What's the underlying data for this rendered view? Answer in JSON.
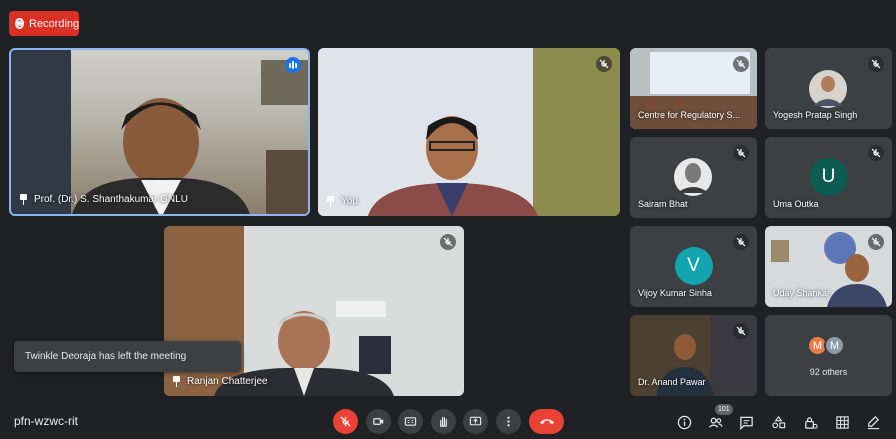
{
  "recording": {
    "label": "Recording"
  },
  "colors": {
    "recording": "#d93025",
    "active_speaker_border": "#8ab4f8",
    "end_call": "#ea4335",
    "avatar_uma": "#0b5c52",
    "avatar_vijoy": "#12a4af",
    "avatar_m1": "#ee7a45",
    "avatar_m2": "#8c9ba7"
  },
  "main_tiles": [
    {
      "name": "Prof. (Dr.) S. Shanthakumar GNLU",
      "speaking": true
    },
    {
      "name": "You",
      "muted": true
    },
    {
      "name": "Ranjan Chatterjee",
      "muted": true
    }
  ],
  "side_tiles": [
    {
      "name": "Centre for Regulatory S...",
      "muted": true
    },
    {
      "name": "Yogesh Pratap Singh",
      "muted": true
    },
    {
      "name": "Sairam Bhat",
      "muted": true
    },
    {
      "name": "Uma Outka",
      "muted": true,
      "initial": "U"
    },
    {
      "name": "Vijoy Kumar Sinha",
      "muted": true,
      "initial": "V"
    },
    {
      "name": "Uday Shankar",
      "muted": true
    },
    {
      "name": "Dr. Anand Pawar",
      "muted": true
    }
  ],
  "others": {
    "initials": [
      "M",
      "M"
    ],
    "count_label": "92 others"
  },
  "toast": {
    "text": "Twinkle Deoraja has left the meeting"
  },
  "meeting": {
    "code": "pfn-wzwc-rit"
  },
  "controls": [
    "mic-off-icon",
    "camera-icon",
    "captions-icon",
    "raise-hand-icon",
    "present-icon",
    "more-icon",
    "end-call-icon"
  ],
  "right_controls": {
    "participants_count": "101",
    "icons": [
      "info-icon",
      "people-icon",
      "chat-icon",
      "activities-icon",
      "host-controls-icon",
      "grid-icon",
      "pen-icon"
    ]
  }
}
